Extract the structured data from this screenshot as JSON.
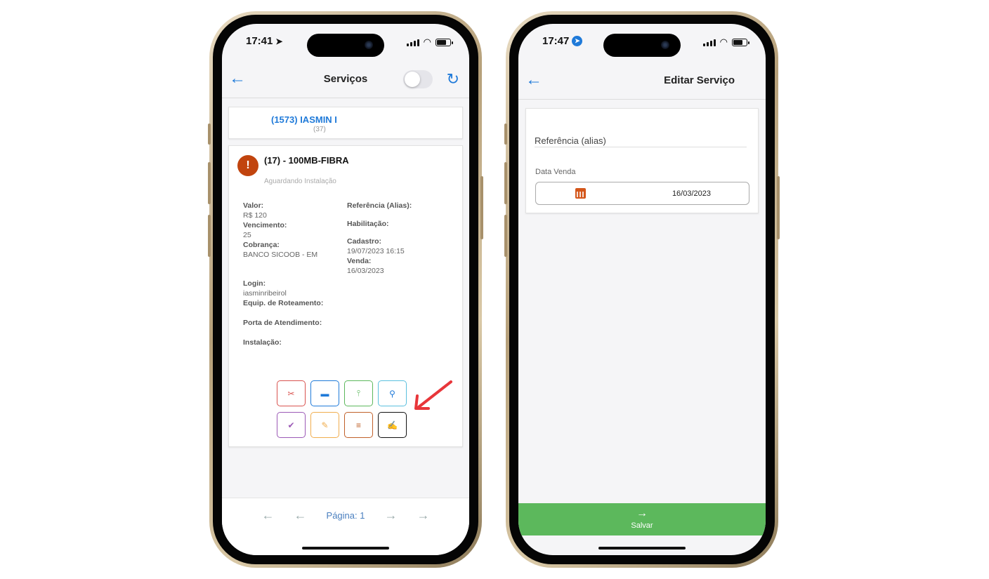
{
  "phone1": {
    "status": {
      "time": "17:41",
      "location_icon": "location-arrow-icon"
    },
    "navbar": {
      "title": "Serviços",
      "back_icon": "back-arrow-icon",
      "refresh_icon": "refresh-icon"
    },
    "client": {
      "name": "(1573) IASMIN I",
      "sub": "(37)"
    },
    "service": {
      "title": "(17) - 100MB-FIBRA",
      "status": "Aguardando Instalação",
      "fields_left": [
        {
          "label": "Valor:",
          "value": "R$ 120"
        },
        {
          "label": "Vencimento:",
          "value": "25"
        },
        {
          "label": "Cobrança:",
          "value": "BANCO SICOOB - EM"
        },
        {
          "label": "Login:",
          "value": "iasminribeirol"
        },
        {
          "label": "Equip. de Roteamento:",
          "value": ""
        },
        {
          "label": "Porta de Atendimento:",
          "value": ""
        },
        {
          "label": "Instalação:",
          "value": ""
        }
      ],
      "fields_right": [
        {
          "label": "Referência (Alias):",
          "value": ""
        },
        {
          "label": "Habilitação:",
          "value": ""
        },
        {
          "label": "Cadastro:",
          "value": "19/07/2023 16:15"
        },
        {
          "label": "Venda:",
          "value": "16/03/2023"
        }
      ],
      "actions": [
        {
          "icon": "scissors-icon",
          "glyph": "✂",
          "color": "#d9534f"
        },
        {
          "icon": "window-icon",
          "glyph": "▬",
          "color": "#1f7ad9"
        },
        {
          "icon": "pin-icon",
          "glyph": "⫯",
          "color": "#5cb85c"
        },
        {
          "icon": "key-icon",
          "glyph": "⚲",
          "color": "#5bc0de"
        },
        {
          "icon": "check-circle-icon",
          "glyph": "✔",
          "color": "#9b59b6"
        },
        {
          "icon": "pencil-icon",
          "glyph": "✎",
          "color": "#f0ad4e"
        },
        {
          "icon": "list-icon",
          "glyph": "≡",
          "color": "#c0602a"
        },
        {
          "icon": "edit-square-icon",
          "glyph": "✍",
          "color": "#111111"
        }
      ]
    },
    "pager": {
      "label": "Página: 1"
    }
  },
  "phone2": {
    "status": {
      "time": "17:47"
    },
    "navbar": {
      "title": "Editar Serviço",
      "back_icon": "back-arrow-icon"
    },
    "form": {
      "reference_placeholder": "Referência (alias)",
      "date_label": "Data Venda",
      "date_value": "16/03/2023"
    },
    "save_label": "Salvar"
  },
  "colors": {
    "accent": "#1f7ad9",
    "save": "#5cb85c",
    "warning": "#c1440e",
    "annotation_arrow": "#e8363a"
  }
}
